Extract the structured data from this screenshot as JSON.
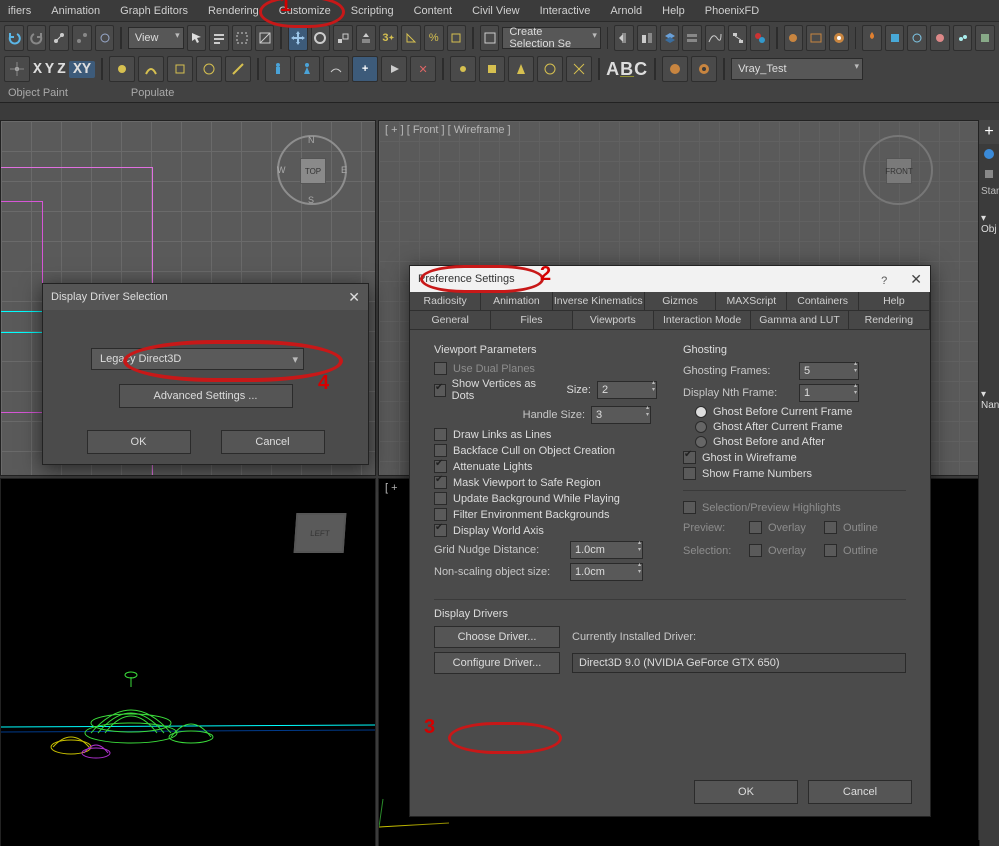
{
  "menu": {
    "items": [
      "ifiers",
      "Animation",
      "Graph Editors",
      "Rendering",
      "Customize",
      "Scripting",
      "Content",
      "Civil View",
      "Interactive",
      "Arnold",
      "Help",
      "PhoenixFD"
    ]
  },
  "annot": {
    "n1": "1",
    "n2": "2",
    "n3": "3",
    "n4": "4"
  },
  "toolbar": {
    "view_dd": "View",
    "selset": "Create Selection Se",
    "vray": "Vray_Test",
    "tags_obj": "Object Paint",
    "tags_pop": "Populate",
    "xyz": {
      "x": "X",
      "y": "Y",
      "z": "Z",
      "xy": "XY"
    }
  },
  "viewport": {
    "front_label": "[ + ] [ Front ] [ Wireframe ]",
    "persp_label": "[ +",
    "cube_top": "TOP",
    "cube_left": "LEFT",
    "cube_front": "FRONT",
    "gizmo_n": "N",
    "gizmo_s": "S",
    "gizmo_e": "E",
    "gizmo_w": "W"
  },
  "cmd": {
    "standard": "Standa",
    "obj": "Obj",
    "nan": "Nan"
  },
  "driver_dlg": {
    "title": "Display Driver Selection",
    "dd_value": "Legacy Direct3D",
    "adv": "Advanced Settings ...",
    "ok": "OK",
    "cancel": "Cancel"
  },
  "prefs_dlg": {
    "title": "Preference Settings",
    "help_q": "?",
    "tabs_row1": [
      "Radiosity",
      "Animation",
      "Inverse Kinematics",
      "Gizmos",
      "MAXScript",
      "Containers",
      "Help"
    ],
    "tabs_row2": [
      "General",
      "Files",
      "Viewports",
      "Interaction Mode",
      "Gamma and LUT",
      "Rendering"
    ],
    "sel_tab": "Viewports",
    "vp_params": "Viewport Parameters",
    "useDual": "Use Dual Planes",
    "showVerts": "Show Vertices as Dots",
    "size_lbl": "Size:",
    "size_val": "2",
    "handle_lbl": "Handle Size:",
    "handle_val": "3",
    "drawLinks": "Draw Links as Lines",
    "backface": "Backface Cull on Object Creation",
    "atten": "Attenuate Lights",
    "mask": "Mask Viewport to Safe Region",
    "updateBg": "Update Background While Playing",
    "filterEnv": "Filter Environment Backgrounds",
    "dispAxis": "Display World Axis",
    "grid_lbl": "Grid Nudge Distance:",
    "grid_val": "1.0cm",
    "nonscale_lbl": "Non-scaling object size:",
    "nonscale_val": "1.0cm",
    "ghosting": "Ghosting",
    "ghostFrames_lbl": "Ghosting Frames:",
    "ghostFrames_val": "5",
    "dispNth_lbl": "Display Nth Frame:",
    "dispNth_val": "1",
    "ghostBefore": "Ghost Before Current Frame",
    "ghostAfter": "Ghost After Current Frame",
    "ghostBoth": "Ghost Before and After",
    "ghostWire": "Ghost in Wireframe",
    "showFrameNum": "Show Frame Numbers",
    "selHigh": "Selection/Preview Highlights",
    "preview_lbl": "Preview:",
    "selection_lbl": "Selection:",
    "overlay": "Overlay",
    "outline": "Outline",
    "drivers_hdr": "Display Drivers",
    "choose": "Choose Driver...",
    "configure": "Configure Driver...",
    "cur_lbl": "Currently Installed Driver:",
    "cur_val": "Direct3D 9.0 (NVIDIA GeForce GTX 650)",
    "ok": "OK",
    "cancel": "Cancel"
  }
}
